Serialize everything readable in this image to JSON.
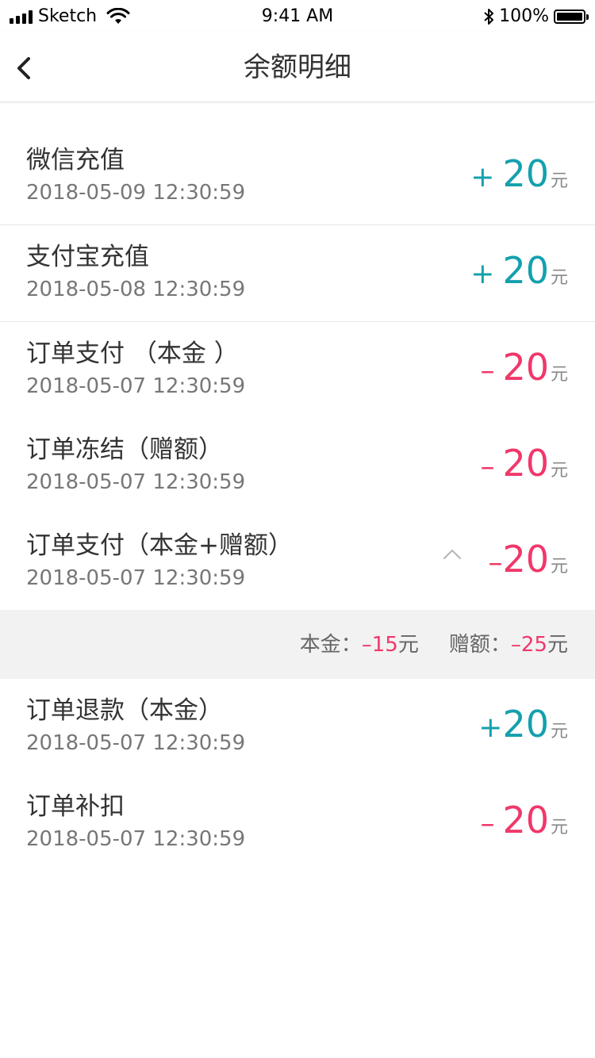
{
  "status_bar": {
    "carrier": "Sketch",
    "time": "9:41 AM",
    "battery": "100%"
  },
  "nav": {
    "title": "余额明细",
    "back_icon": "chevron-left-icon"
  },
  "colors": {
    "positive": "#14a0ae",
    "negative": "#f0386a"
  },
  "transactions": [
    {
      "title": "微信充值",
      "time": "2018-05-09 12:30:59",
      "sign": "+",
      "amount": "20",
      "unit": "元"
    },
    {
      "title": "支付宝充值",
      "time": "2018-05-08 12:30:59",
      "sign": "+",
      "amount": "20",
      "unit": "元"
    },
    {
      "title": "订单支付 （本金 ）",
      "time": "2018-05-07 12:30:59",
      "sign": "–",
      "amount": "20",
      "unit": "元"
    },
    {
      "title": "订单冻结（赠额）",
      "time": "2018-05-07 12:30:59",
      "sign": "–",
      "amount": "20",
      "unit": "元"
    },
    {
      "title": "订单支付（本金+赠额）",
      "time": "2018-05-07 12:30:59",
      "sign": "–",
      "amount": "20",
      "unit": "元"
    },
    {
      "title": "订单退款（本金）",
      "time": "2018-05-07 12:30:59",
      "sign": "+",
      "amount": "20",
      "unit": "元"
    },
    {
      "title": "订单补扣",
      "time": "2018-05-07 12:30:59",
      "sign": "–",
      "amount": "20",
      "unit": "元"
    }
  ],
  "breakdown": {
    "principal_label": "本金：",
    "principal_value": "–15",
    "principal_unit": "元",
    "bonus_label": "赠额：",
    "bonus_value": "–25",
    "bonus_unit": "元"
  }
}
